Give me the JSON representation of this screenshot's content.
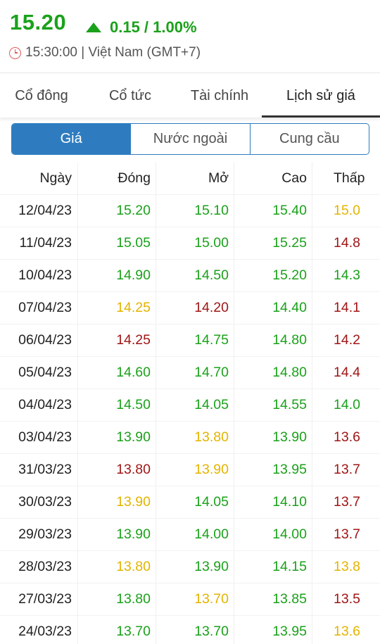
{
  "header": {
    "price": "15.20",
    "change": "0.15 / 1.00%",
    "time": "15:30:00 | Việt Nam (GMT+7)"
  },
  "tabs": [
    "Cổ đông",
    "Cổ tức",
    "Tài chính",
    "Lịch sử giá"
  ],
  "active_tab": 3,
  "segments": [
    "Giá",
    "Nước ngoài",
    "Cung cầu"
  ],
  "active_segment": 0,
  "colors": {
    "up": "#1aa11a",
    "reference": "#e3b400",
    "down": "#a01616",
    "accent": "#2e7cbf"
  },
  "table": {
    "columns": [
      "Ngày",
      "Đóng",
      "Mở",
      "Cao",
      "Thấp"
    ],
    "rows": [
      {
        "date": "12/04/23",
        "close": [
          "15.20",
          "up"
        ],
        "open": [
          "15.10",
          "up"
        ],
        "high": [
          "15.40",
          "up"
        ],
        "low": [
          "15.0",
          "ref"
        ]
      },
      {
        "date": "11/04/23",
        "close": [
          "15.05",
          "up"
        ],
        "open": [
          "15.00",
          "up"
        ],
        "high": [
          "15.25",
          "up"
        ],
        "low": [
          "14.8",
          "down"
        ]
      },
      {
        "date": "10/04/23",
        "close": [
          "14.90",
          "up"
        ],
        "open": [
          "14.50",
          "up"
        ],
        "high": [
          "15.20",
          "up"
        ],
        "low": [
          "14.3",
          "up"
        ]
      },
      {
        "date": "07/04/23",
        "close": [
          "14.25",
          "ref"
        ],
        "open": [
          "14.20",
          "down"
        ],
        "high": [
          "14.40",
          "up"
        ],
        "low": [
          "14.1",
          "down"
        ]
      },
      {
        "date": "06/04/23",
        "close": [
          "14.25",
          "down"
        ],
        "open": [
          "14.75",
          "up"
        ],
        "high": [
          "14.80",
          "up"
        ],
        "low": [
          "14.2",
          "down"
        ]
      },
      {
        "date": "05/04/23",
        "close": [
          "14.60",
          "up"
        ],
        "open": [
          "14.70",
          "up"
        ],
        "high": [
          "14.80",
          "up"
        ],
        "low": [
          "14.4",
          "down"
        ]
      },
      {
        "date": "04/04/23",
        "close": [
          "14.50",
          "up"
        ],
        "open": [
          "14.05",
          "up"
        ],
        "high": [
          "14.55",
          "up"
        ],
        "low": [
          "14.0",
          "up"
        ]
      },
      {
        "date": "03/04/23",
        "close": [
          "13.90",
          "up"
        ],
        "open": [
          "13.80",
          "ref"
        ],
        "high": [
          "13.90",
          "up"
        ],
        "low": [
          "13.6",
          "down"
        ]
      },
      {
        "date": "31/03/23",
        "close": [
          "13.80",
          "down"
        ],
        "open": [
          "13.90",
          "ref"
        ],
        "high": [
          "13.95",
          "up"
        ],
        "low": [
          "13.7",
          "down"
        ]
      },
      {
        "date": "30/03/23",
        "close": [
          "13.90",
          "ref"
        ],
        "open": [
          "14.05",
          "up"
        ],
        "high": [
          "14.10",
          "up"
        ],
        "low": [
          "13.7",
          "down"
        ]
      },
      {
        "date": "29/03/23",
        "close": [
          "13.90",
          "up"
        ],
        "open": [
          "14.00",
          "up"
        ],
        "high": [
          "14.00",
          "up"
        ],
        "low": [
          "13.7",
          "down"
        ]
      },
      {
        "date": "28/03/23",
        "close": [
          "13.80",
          "ref"
        ],
        "open": [
          "13.90",
          "up"
        ],
        "high": [
          "14.15",
          "up"
        ],
        "low": [
          "13.8",
          "ref"
        ]
      },
      {
        "date": "27/03/23",
        "close": [
          "13.80",
          "up"
        ],
        "open": [
          "13.70",
          "ref"
        ],
        "high": [
          "13.85",
          "up"
        ],
        "low": [
          "13.5",
          "down"
        ]
      },
      {
        "date": "24/03/23",
        "close": [
          "13.70",
          "up"
        ],
        "open": [
          "13.70",
          "up"
        ],
        "high": [
          "13.95",
          "up"
        ],
        "low": [
          "13.6",
          "ref"
        ]
      }
    ]
  }
}
